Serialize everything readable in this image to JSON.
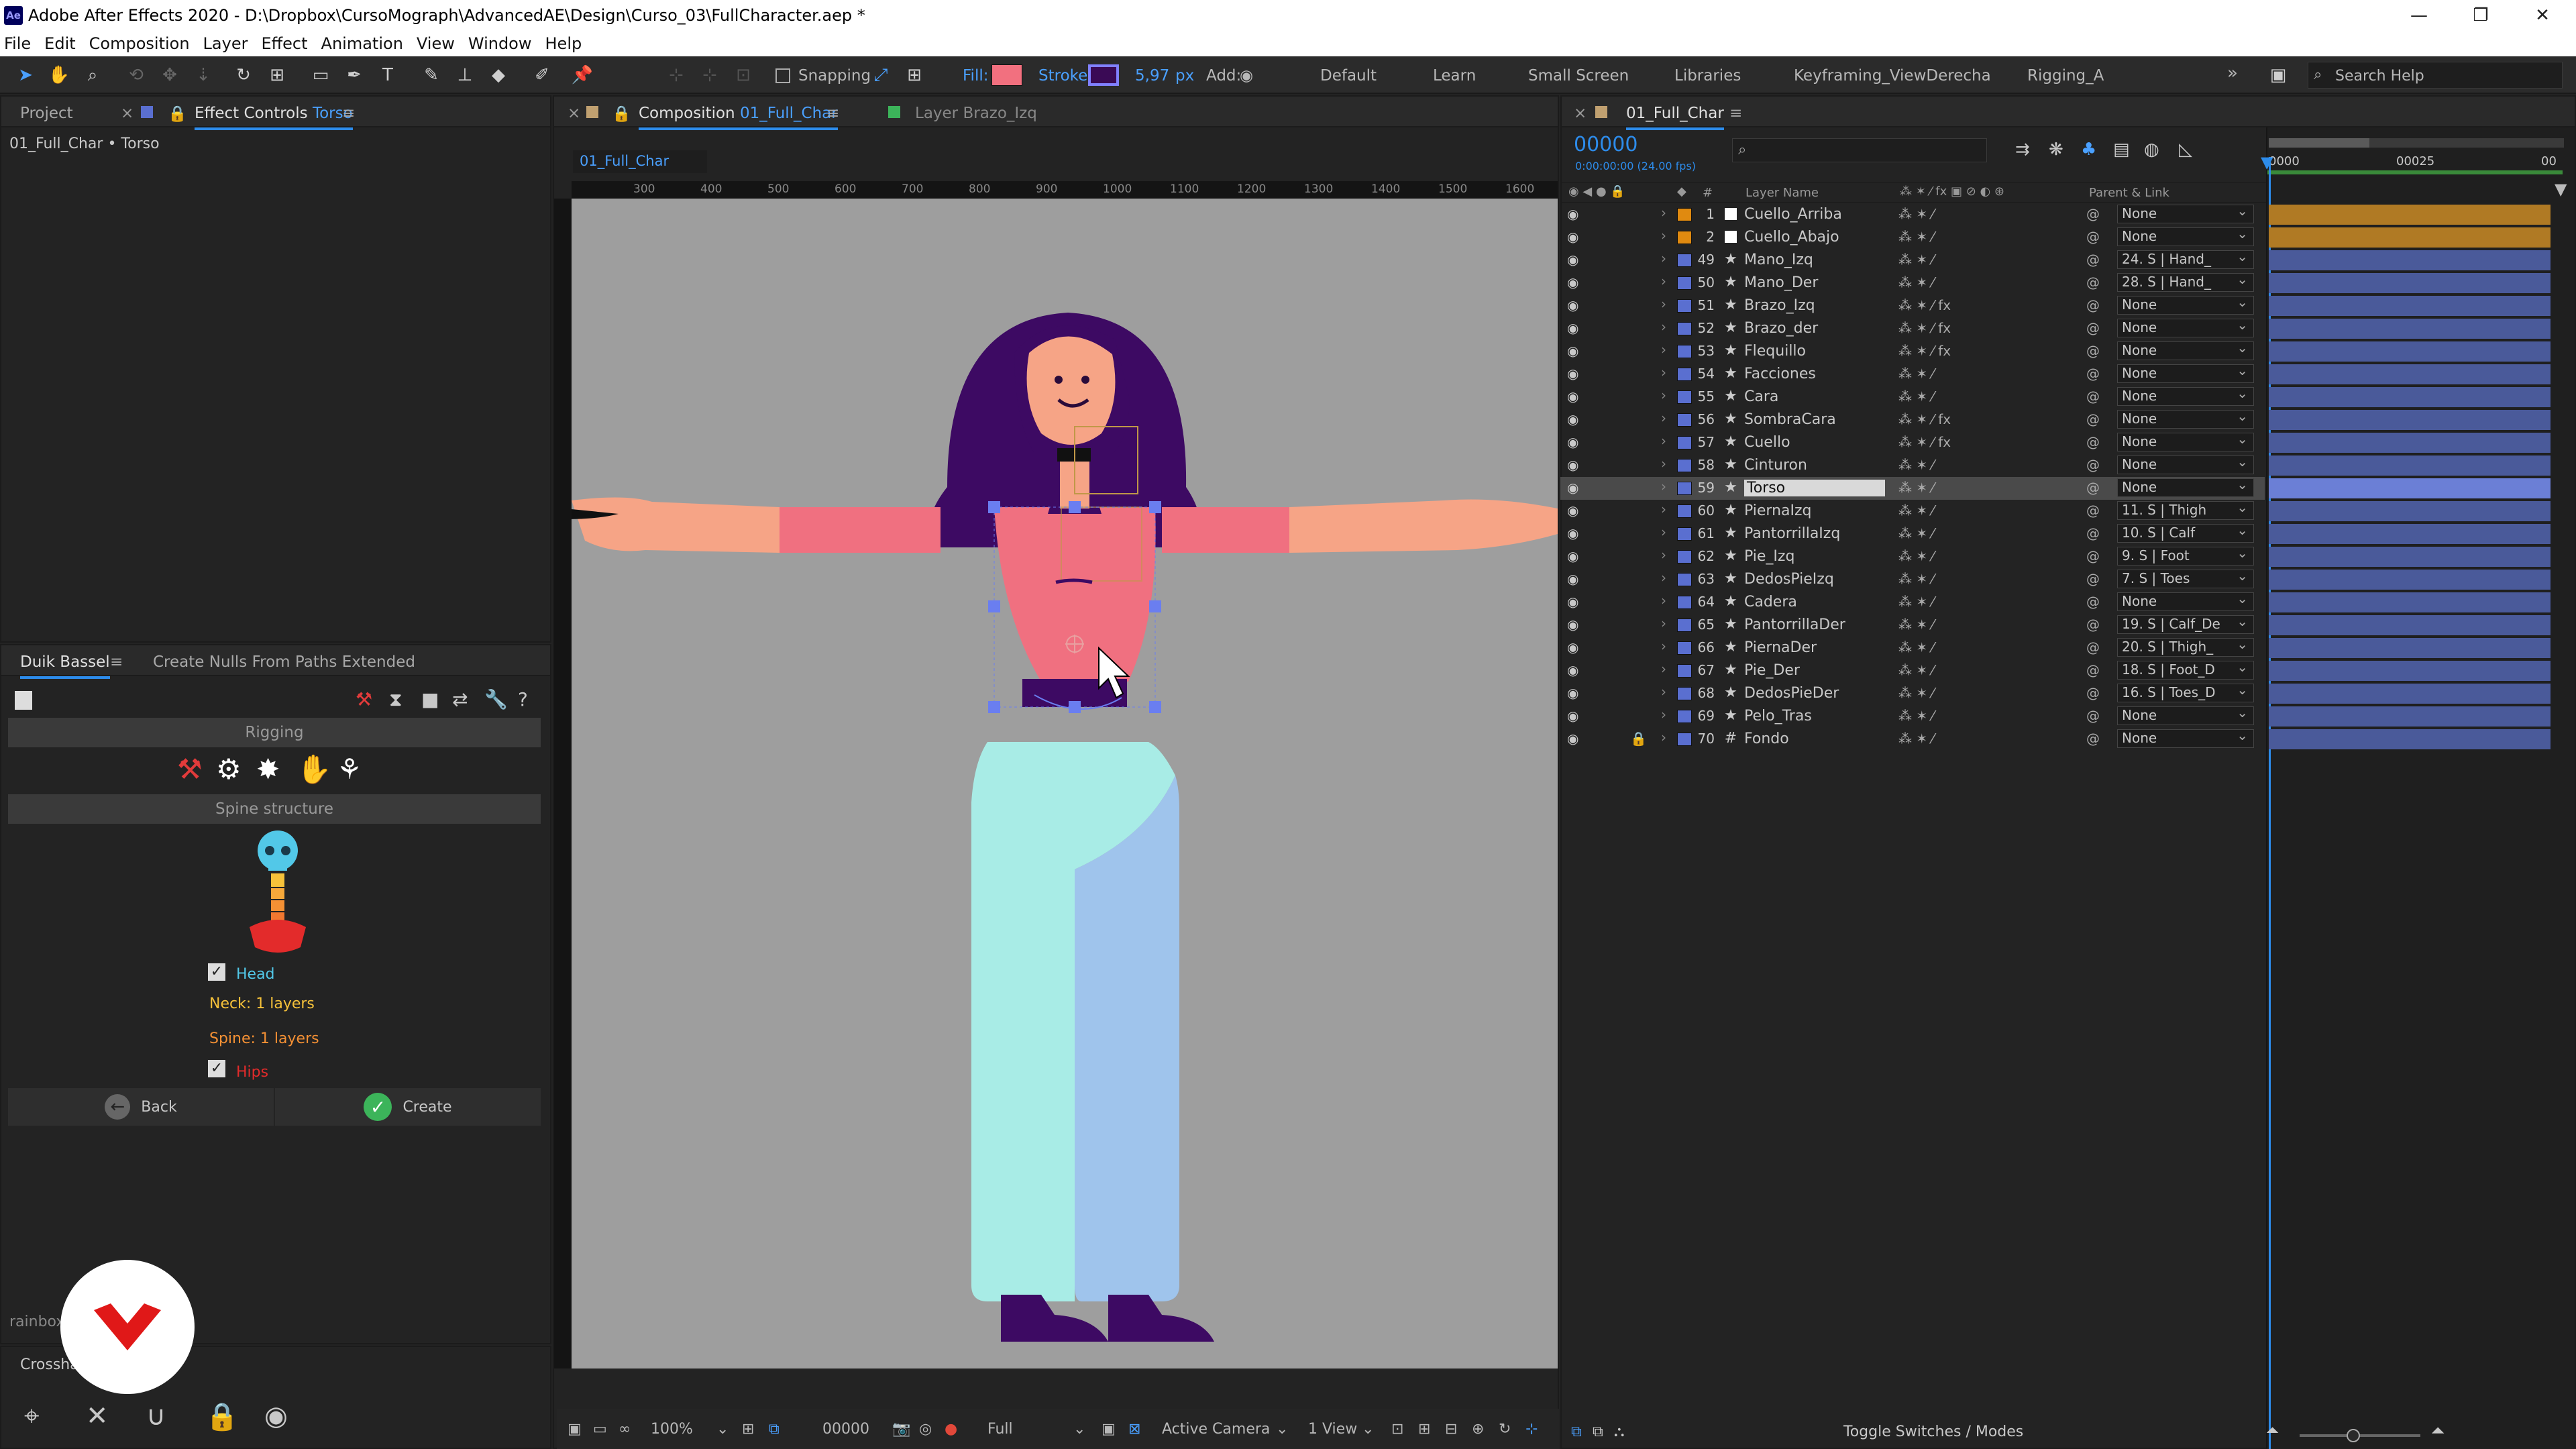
{
  "window": {
    "title": "Adobe After Effects 2020 - D:\\Dropbox\\CursoMograph\\AdvancedAE\\Design\\Curso_03\\FullCharacter.aep *",
    "logo": "Ae"
  },
  "menu": [
    "File",
    "Edit",
    "Composition",
    "Layer",
    "Effect",
    "Animation",
    "View",
    "Window",
    "Help"
  ],
  "toolbar": {
    "snapping": "Snapping",
    "fill": "Fill:",
    "stroke": "Stroke:",
    "stroke_width": "5,97",
    "stroke_unit": "px",
    "add": "Add:",
    "fill_color": "#f2707f",
    "stroke_color": "#3a0a55"
  },
  "workspaces": [
    "Default",
    "Learn",
    "Small Screen",
    "Libraries",
    "Keyframing_ViewDerecha",
    "Rigging_A"
  ],
  "search_help": "Search Help",
  "left_panel": {
    "tab_project": "Project",
    "tab_effect_controls": "Effect Controls",
    "effect_controls_layer": "Torso",
    "breadcrumb": "01_Full_Char • Torso"
  },
  "duik": {
    "tab_duik": "Duik Bassel",
    "tab_nulls": "Create Nulls From Paths Extended",
    "section_rigging": "Rigging",
    "section_spine": "Spine structure",
    "head_label": "Head",
    "neck_label": "Neck: 1 layers",
    "spine_label": "Spine: 1 layers",
    "hips_label": "Hips",
    "back_label": "Back",
    "create_label": "Create",
    "head_checked": true,
    "hips_checked": true
  },
  "bottom_panel": {
    "tab_rainbox": "rainbox",
    "tab_crosshair": "Crossha"
  },
  "comp_panel": {
    "tab_composition": "Composition",
    "comp_name": "01_Full_Char",
    "tab_layer": "Layer",
    "layer_name": "Brazo_Izq",
    "sub_tab": "01_Full_Char"
  },
  "ruler": [
    "300",
    "400",
    "500",
    "600",
    "700",
    "800",
    "900",
    "1000",
    "1100",
    "1200",
    "1300",
    "1400",
    "1500",
    "1600"
  ],
  "comp_footer": {
    "zoom": "100%",
    "timecode": "00000",
    "resolution": "Full",
    "camera": "Active Camera",
    "views": "1 View"
  },
  "timeline": {
    "tab": "01_Full_Char",
    "timecode": "00000",
    "timecode_sub": "0:00:00:00 (24.00 fps)",
    "col_num": "#",
    "col_layer": "Layer Name",
    "col_parent": "Parent & Link",
    "ruler_start": "0000",
    "ruler_mid": "00025",
    "ruler_end": "00",
    "footer": "Toggle Switches / Modes",
    "layers": [
      {
        "num": "1",
        "name": "Cuello_Arriba",
        "parent": "None",
        "label": "#e08a10",
        "type": "white",
        "fx": false,
        "bar": "#b07a24",
        "locked": false
      },
      {
        "num": "2",
        "name": "Cuello_Abajo",
        "parent": "None",
        "label": "#e08a10",
        "type": "white",
        "fx": false,
        "bar": "#b07a24",
        "locked": false
      },
      {
        "num": "49",
        "name": "Mano_Izq",
        "parent": "24. S | Hand_",
        "label": "#5a6fd0",
        "type": "★",
        "fx": false,
        "bar": "#4a5a9a",
        "locked": false
      },
      {
        "num": "50",
        "name": "Mano_Der",
        "parent": "28. S | Hand_",
        "label": "#5a6fd0",
        "type": "★",
        "fx": false,
        "bar": "#4a5a9a",
        "locked": false
      },
      {
        "num": "51",
        "name": "Brazo_Izq",
        "parent": "None",
        "label": "#5a6fd0",
        "type": "★",
        "fx": true,
        "bar": "#4a5a9a",
        "locked": false
      },
      {
        "num": "52",
        "name": "Brazo_der",
        "parent": "None",
        "label": "#5a6fd0",
        "type": "★",
        "fx": true,
        "bar": "#4a5a9a",
        "locked": false
      },
      {
        "num": "53",
        "name": "Flequillo",
        "parent": "None",
        "label": "#5a6fd0",
        "type": "★",
        "fx": true,
        "bar": "#4a5a9a",
        "locked": false
      },
      {
        "num": "54",
        "name": "Facciones",
        "parent": "None",
        "label": "#5a6fd0",
        "type": "★",
        "fx": false,
        "bar": "#4a5a9a",
        "locked": false
      },
      {
        "num": "55",
        "name": "Cara",
        "parent": "None",
        "label": "#5a6fd0",
        "type": "★",
        "fx": false,
        "bar": "#4a5a9a",
        "locked": false
      },
      {
        "num": "56",
        "name": "SombraCara",
        "parent": "None",
        "label": "#5a6fd0",
        "type": "★",
        "fx": true,
        "bar": "#4a5a9a",
        "locked": false
      },
      {
        "num": "57",
        "name": "Cuello",
        "parent": "None",
        "label": "#5a6fd0",
        "type": "★",
        "fx": true,
        "bar": "#4a5a9a",
        "locked": false
      },
      {
        "num": "58",
        "name": "Cinturon",
        "parent": "None",
        "label": "#5a6fd0",
        "type": "★",
        "fx": false,
        "bar": "#4a5a9a",
        "locked": false
      },
      {
        "num": "59",
        "name": "Torso",
        "parent": "None",
        "label": "#5a6fd0",
        "type": "★",
        "fx": false,
        "bar": "#6b7fd6",
        "locked": false,
        "selected": true
      },
      {
        "num": "60",
        "name": "PiernaIzq",
        "parent": "11. S | Thigh",
        "label": "#5a6fd0",
        "type": "★",
        "fx": false,
        "bar": "#4a5a9a",
        "locked": false
      },
      {
        "num": "61",
        "name": "PantorrillaIzq",
        "parent": "10. S | Calf",
        "label": "#5a6fd0",
        "type": "★",
        "fx": false,
        "bar": "#4a5a9a",
        "locked": false
      },
      {
        "num": "62",
        "name": "Pie_Izq",
        "parent": "9. S | Foot",
        "label": "#5a6fd0",
        "type": "★",
        "fx": false,
        "bar": "#4a5a9a",
        "locked": false
      },
      {
        "num": "63",
        "name": "DedosPieIzq",
        "parent": "7. S | Toes",
        "label": "#5a6fd0",
        "type": "★",
        "fx": false,
        "bar": "#4a5a9a",
        "locked": false
      },
      {
        "num": "64",
        "name": "Cadera",
        "parent": "None",
        "label": "#5a6fd0",
        "type": "★",
        "fx": false,
        "bar": "#4a5a9a",
        "locked": false
      },
      {
        "num": "65",
        "name": "PantorrillaDer",
        "parent": "19. S | Calf_De",
        "label": "#5a6fd0",
        "type": "★",
        "fx": false,
        "bar": "#4a5a9a",
        "locked": false
      },
      {
        "num": "66",
        "name": "PiernaDer",
        "parent": "20. S | Thigh_",
        "label": "#5a6fd0",
        "type": "★",
        "fx": false,
        "bar": "#4a5a9a",
        "locked": false
      },
      {
        "num": "67",
        "name": "Pie_Der",
        "parent": "18. S | Foot_D",
        "label": "#5a6fd0",
        "type": "★",
        "fx": false,
        "bar": "#4a5a9a",
        "locked": false
      },
      {
        "num": "68",
        "name": "DedosPieDer",
        "parent": "16. S | Toes_D",
        "label": "#5a6fd0",
        "type": "★",
        "fx": false,
        "bar": "#4a5a9a",
        "locked": false
      },
      {
        "num": "69",
        "name": "Pelo_Tras",
        "parent": "None",
        "label": "#5a6fd0",
        "type": "★",
        "fx": false,
        "bar": "#4a5a9a",
        "locked": false
      },
      {
        "num": "70",
        "name": "Fondo",
        "parent": "None",
        "label": "#5a6fd0",
        "type": "#",
        "fx": false,
        "bar": "#4a5a9a",
        "locked": true
      }
    ]
  }
}
